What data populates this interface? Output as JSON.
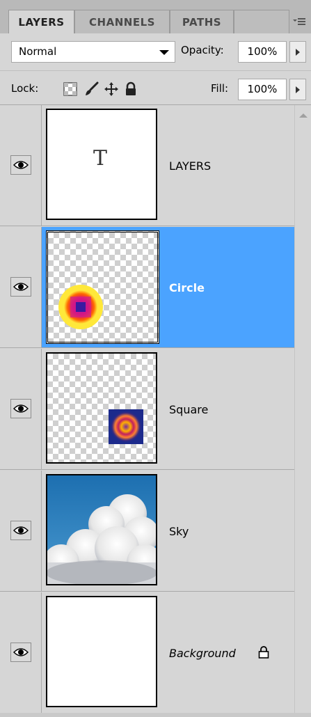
{
  "tabs": [
    {
      "label": "LAYERS",
      "active": true
    },
    {
      "label": "CHANNELS",
      "active": false
    },
    {
      "label": "PATHS",
      "active": false
    }
  ],
  "panel_menu_icon": "panel-menu-icon",
  "blend_mode": {
    "value": "Normal"
  },
  "opacity": {
    "label": "Opacity:",
    "value": "100%"
  },
  "lock": {
    "label": "Lock:",
    "icons": [
      "lock-transparent-pixels-icon",
      "lock-image-pixels-icon",
      "lock-position-icon",
      "lock-all-icon"
    ]
  },
  "fill": {
    "label": "Fill:",
    "value": "100%"
  },
  "layers": [
    {
      "name": "LAYERS",
      "thumbnail": "type-layer",
      "visible": true,
      "selected": false,
      "locked": false,
      "thumb_glyph": "T"
    },
    {
      "name": "Circle",
      "thumbnail": "circle-gradient",
      "visible": true,
      "selected": true,
      "locked": false
    },
    {
      "name": "Square",
      "thumbnail": "square-gradient",
      "visible": true,
      "selected": false,
      "locked": false
    },
    {
      "name": "Sky",
      "thumbnail": "sky-clouds",
      "visible": true,
      "selected": false,
      "locked": false
    },
    {
      "name": "Background",
      "thumbnail": "white",
      "visible": true,
      "selected": false,
      "locked": true
    }
  ],
  "colors": {
    "panel_bg": "#d6d6d6",
    "selection": "#4ba3ff",
    "tab_bar": "#b9b9b9"
  }
}
